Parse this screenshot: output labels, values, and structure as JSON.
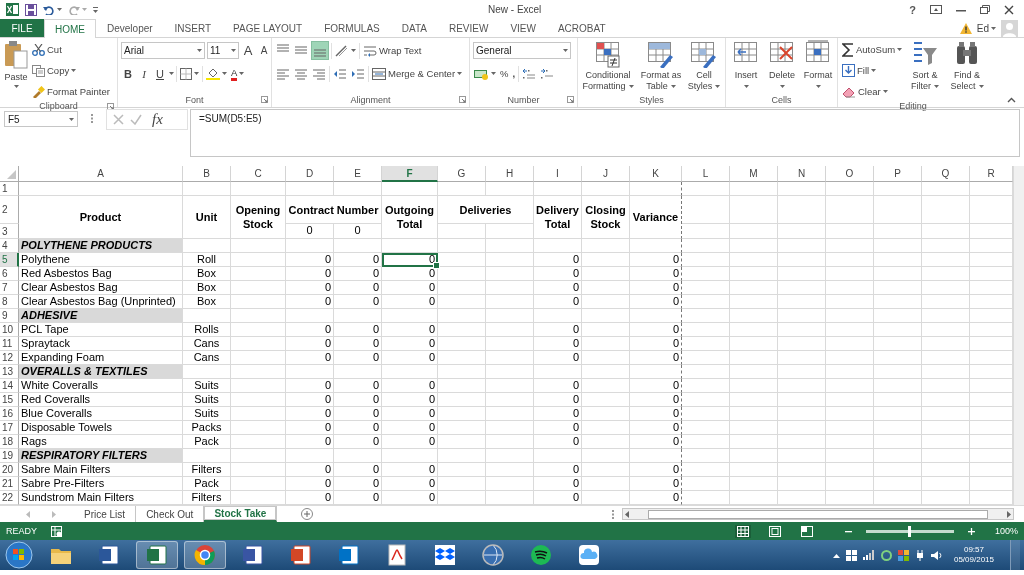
{
  "title_bar": {
    "title": "New - Excel",
    "help": "?"
  },
  "ribbon_tabs": [
    {
      "label": "FILE",
      "kind": "file",
      "selected": false
    },
    {
      "label": "HOME",
      "kind": "tab",
      "selected": true
    },
    {
      "label": "Developer",
      "kind": "tab",
      "selected": false
    },
    {
      "label": "INSERT",
      "kind": "tab",
      "selected": false
    },
    {
      "label": "PAGE LAYOUT",
      "kind": "tab",
      "selected": false
    },
    {
      "label": "FORMULAS",
      "kind": "tab",
      "selected": false
    },
    {
      "label": "DATA",
      "kind": "tab",
      "selected": false
    },
    {
      "label": "REVIEW",
      "kind": "tab",
      "selected": false
    },
    {
      "label": "VIEW",
      "kind": "tab",
      "selected": false
    },
    {
      "label": "ACROBAT",
      "kind": "tab",
      "selected": false
    }
  ],
  "account": {
    "name": "Ed"
  },
  "ribbon": [
    {
      "kind": "clipboard",
      "label": "Clipboard",
      "launcher": true,
      "items": [
        {
          "label": "Paste"
        },
        {
          "label": "Cut"
        },
        {
          "label": "Copy"
        },
        {
          "label": "Format Painter"
        }
      ]
    },
    {
      "kind": "font",
      "label": "Font",
      "launcher": true,
      "font": "Arial",
      "size": "11",
      "grow": "A",
      "shrink": "A",
      "styles": [
        "B",
        "I",
        "U"
      ],
      "font_color": "A"
    },
    {
      "kind": "alignment",
      "label": "Alignment",
      "launcher": true,
      "vertical": [
        {
          "selected": false
        },
        {
          "selected": false
        },
        {
          "selected": true
        }
      ],
      "wrap": "Wrap Text",
      "merge": "Merge & Center"
    },
    {
      "kind": "number",
      "label": "Number",
      "launcher": true,
      "format": "General",
      "percent": "%",
      "comma": ","
    },
    {
      "kind": "styles",
      "label": "Styles",
      "launcher": false,
      "items": [
        {
          "label": "Conditional Formatting"
        },
        {
          "label": "Format as Table"
        },
        {
          "label": "Cell Styles"
        }
      ]
    },
    {
      "kind": "cells",
      "label": "Cells",
      "launcher": false,
      "items": [
        {
          "label": "Insert"
        },
        {
          "label": "Delete"
        },
        {
          "label": "Format"
        }
      ]
    },
    {
      "kind": "editing",
      "label": "Editing",
      "launcher": false,
      "items": [
        {
          "label": "AutoSum"
        },
        {
          "label": "Fill"
        },
        {
          "label": "Clear"
        },
        {
          "label": "Sort & Filter"
        },
        {
          "label": "Find & Select"
        }
      ]
    }
  ],
  "formula_bar": {
    "name_box": "F5",
    "fx": "fx",
    "formula": "=SUM(D5:E5)"
  },
  "sheet": {
    "columns": [
      {
        "label": "A",
        "selected": false
      },
      {
        "label": "B",
        "selected": false
      },
      {
        "label": "C",
        "selected": false
      },
      {
        "label": "D",
        "selected": false
      },
      {
        "label": "E",
        "selected": false
      },
      {
        "label": "F",
        "selected": true
      },
      {
        "label": "G",
        "selected": false
      },
      {
        "label": "H",
        "selected": false
      },
      {
        "label": "I",
        "selected": false
      },
      {
        "label": "J",
        "selected": false
      },
      {
        "label": "K",
        "selected": false
      },
      {
        "label": "L",
        "selected": false
      },
      {
        "label": "M",
        "selected": false
      },
      {
        "label": "N",
        "selected": false
      },
      {
        "label": "O",
        "selected": false
      },
      {
        "label": "P",
        "selected": false
      },
      {
        "label": "Q",
        "selected": false
      },
      {
        "label": "R",
        "selected": false
      }
    ],
    "rows": [
      {
        "kind": "blank",
        "number": "1",
        "selected": false
      },
      {
        "kind": "header",
        "numbers": [
          {
            "number": "2",
            "selected": false
          },
          {
            "number": "3",
            "selected": false
          }
        ],
        "titles": [
          "Product",
          "Unit",
          "Opening Stock",
          "Contract Number",
          "Outgoing Total",
          "Deliveries",
          "Delivery Total",
          "Closing Stock",
          "Variance"
        ],
        "sub_values": [
          "0",
          "0"
        ]
      },
      {
        "kind": "section",
        "number": "4",
        "selected": false,
        "title": "POLYTHENE PRODUCTS"
      },
      {
        "kind": "item",
        "number": "5",
        "selected": true,
        "name": "Polythene",
        "unit": "Roll",
        "values": [
          {
            "text": "0",
            "selected": false
          },
          {
            "text": "0",
            "selected": false
          },
          {
            "text": "0",
            "selected": true
          },
          {
            "text": "0",
            "selected": false
          },
          {
            "text": "0",
            "selected": false
          }
        ]
      },
      {
        "kind": "item",
        "number": "6",
        "selected": false,
        "name": "Red Asbestos Bag",
        "unit": "Box",
        "values": [
          {
            "text": "0",
            "selected": false
          },
          {
            "text": "0",
            "selected": false
          },
          {
            "text": "0",
            "selected": false
          },
          {
            "text": "0",
            "selected": false
          },
          {
            "text": "0",
            "selected": false
          }
        ]
      },
      {
        "kind": "item",
        "number": "7",
        "selected": false,
        "name": "Clear Asbestos Bag",
        "unit": "Box",
        "values": [
          {
            "text": "0",
            "selected": false
          },
          {
            "text": "0",
            "selected": false
          },
          {
            "text": "0",
            "selected": false
          },
          {
            "text": "0",
            "selected": false
          },
          {
            "text": "0",
            "selected": false
          }
        ]
      },
      {
        "kind": "item",
        "number": "8",
        "selected": false,
        "name": "Clear Asbestos Bag (Unprinted)",
        "unit": "Box",
        "values": [
          {
            "text": "0",
            "selected": false
          },
          {
            "text": "0",
            "selected": false
          },
          {
            "text": "0",
            "selected": false
          },
          {
            "text": "0",
            "selected": false
          },
          {
            "text": "0",
            "selected": false
          }
        ]
      },
      {
        "kind": "section",
        "number": "9",
        "selected": false,
        "title": "ADHESIVE"
      },
      {
        "kind": "item",
        "number": "10",
        "selected": false,
        "name": "PCL Tape",
        "unit": "Rolls",
        "values": [
          {
            "text": "0",
            "selected": false
          },
          {
            "text": "0",
            "selected": false
          },
          {
            "text": "0",
            "selected": false
          },
          {
            "text": "0",
            "selected": false
          },
          {
            "text": "0",
            "selected": false
          }
        ]
      },
      {
        "kind": "item",
        "number": "11",
        "selected": false,
        "name": "Spraytack",
        "unit": "Cans",
        "values": [
          {
            "text": "0",
            "selected": false
          },
          {
            "text": "0",
            "selected": false
          },
          {
            "text": "0",
            "selected": false
          },
          {
            "text": "0",
            "selected": false
          },
          {
            "text": "0",
            "selected": false
          }
        ]
      },
      {
        "kind": "item",
        "number": "12",
        "selected": false,
        "name": "Expanding Foam",
        "unit": "Cans",
        "values": [
          {
            "text": "0",
            "selected": false
          },
          {
            "text": "0",
            "selected": false
          },
          {
            "text": "0",
            "selected": false
          },
          {
            "text": "0",
            "selected": false
          },
          {
            "text": "0",
            "selected": false
          }
        ]
      },
      {
        "kind": "section",
        "number": "13",
        "selected": false,
        "title": "OVERALLS & TEXTILES"
      },
      {
        "kind": "item",
        "number": "14",
        "selected": false,
        "name": "White Coveralls",
        "unit": "Suits",
        "values": [
          {
            "text": "0",
            "selected": false
          },
          {
            "text": "0",
            "selected": false
          },
          {
            "text": "0",
            "selected": false
          },
          {
            "text": "0",
            "selected": false
          },
          {
            "text": "0",
            "selected": false
          }
        ]
      },
      {
        "kind": "item",
        "number": "15",
        "selected": false,
        "name": "Red Coveralls",
        "unit": "Suits",
        "values": [
          {
            "text": "0",
            "selected": false
          },
          {
            "text": "0",
            "selected": false
          },
          {
            "text": "0",
            "selected": false
          },
          {
            "text": "0",
            "selected": false
          },
          {
            "text": "0",
            "selected": false
          }
        ]
      },
      {
        "kind": "item",
        "number": "16",
        "selected": false,
        "name": "Blue Coveralls",
        "unit": "Suits",
        "values": [
          {
            "text": "0",
            "selected": false
          },
          {
            "text": "0",
            "selected": false
          },
          {
            "text": "0",
            "selected": false
          },
          {
            "text": "0",
            "selected": false
          },
          {
            "text": "0",
            "selected": false
          }
        ]
      },
      {
        "kind": "item",
        "number": "17",
        "selected": false,
        "name": "Disposable Towels",
        "unit": "Packs",
        "values": [
          {
            "text": "0",
            "selected": false
          },
          {
            "text": "0",
            "selected": false
          },
          {
            "text": "0",
            "selected": false
          },
          {
            "text": "0",
            "selected": false
          },
          {
            "text": "0",
            "selected": false
          }
        ]
      },
      {
        "kind": "item",
        "number": "18",
        "selected": false,
        "name": "Rags",
        "unit": "Pack",
        "values": [
          {
            "text": "0",
            "selected": false
          },
          {
            "text": "0",
            "selected": false
          },
          {
            "text": "0",
            "selected": false
          },
          {
            "text": "0",
            "selected": false
          },
          {
            "text": "0",
            "selected": false
          }
        ]
      },
      {
        "kind": "section",
        "number": "19",
        "selected": false,
        "title": "RESPIRATORY FILTERS"
      },
      {
        "kind": "item",
        "number": "20",
        "selected": false,
        "name": "Sabre Main Filters",
        "unit": "Filters",
        "values": [
          {
            "text": "0",
            "selected": false
          },
          {
            "text": "0",
            "selected": false
          },
          {
            "text": "0",
            "selected": false
          },
          {
            "text": "0",
            "selected": false
          },
          {
            "text": "0",
            "selected": false
          }
        ]
      },
      {
        "kind": "item",
        "number": "21",
        "selected": false,
        "name": "Sabre Pre-Filters",
        "unit": "Pack",
        "values": [
          {
            "text": "0",
            "selected": false
          },
          {
            "text": "0",
            "selected": false
          },
          {
            "text": "0",
            "selected": false
          },
          {
            "text": "0",
            "selected": false
          },
          {
            "text": "0",
            "selected": false
          }
        ]
      },
      {
        "kind": "item",
        "number": "22",
        "selected": false,
        "name": "Sundstrom Main Filters",
        "unit": "Filters",
        "values": [
          {
            "text": "0",
            "selected": false
          },
          {
            "text": "0",
            "selected": false
          },
          {
            "text": "0",
            "selected": false
          },
          {
            "text": "0",
            "selected": false
          },
          {
            "text": "0",
            "selected": false
          }
        ]
      }
    ]
  },
  "sheet_tabs": [
    {
      "label": "Price List",
      "selected": false
    },
    {
      "label": "Check Out",
      "selected": false
    },
    {
      "label": "Stock Take",
      "selected": true
    }
  ],
  "status_bar": {
    "mode": "READY",
    "views": [
      {
        "selected": true
      },
      {
        "selected": false
      },
      {
        "selected": false
      }
    ],
    "zoom": {
      "level": 0.5,
      "reading": "100%"
    }
  },
  "taskbar": {
    "apps": [
      {
        "kind": "folder",
        "active": false
      },
      {
        "kind": "tile",
        "color": "#2b579a",
        "active": false
      },
      {
        "kind": "tile",
        "color": "#217346",
        "active": true
      },
      {
        "kind": "ring",
        "active": true
      },
      {
        "kind": "tile",
        "color": "#3955a3",
        "active": false
      },
      {
        "kind": "tile",
        "color": "#d24726",
        "active": false
      },
      {
        "kind": "tile",
        "color": "#0072c6",
        "active": false
      },
      {
        "kind": "pdf",
        "active": false
      },
      {
        "kind": "box",
        "active": false
      },
      {
        "kind": "globe",
        "active": false
      },
      {
        "kind": "disc",
        "active": false
      },
      {
        "kind": "cloud",
        "active": false
      }
    ],
    "clock": {
      "time": "09:57",
      "date": "05/09/2015"
    }
  }
}
